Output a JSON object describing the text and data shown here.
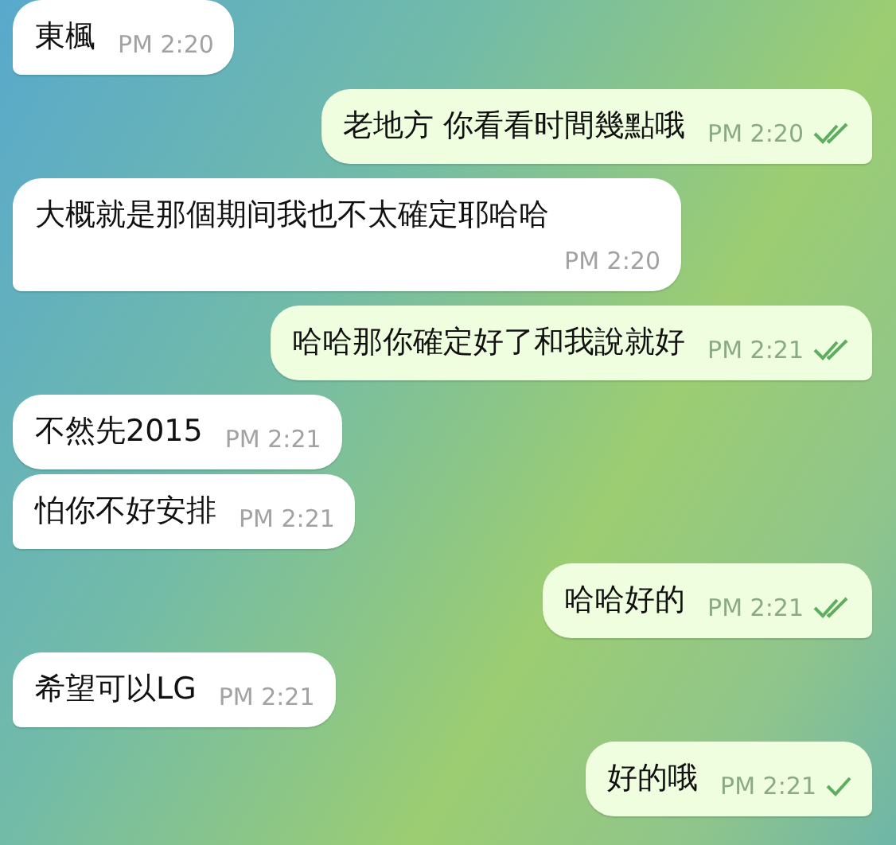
{
  "messages": [
    {
      "outgoing": false,
      "text": "東楓",
      "time": "PM 2:20",
      "tail": true
    },
    {
      "outgoing": true,
      "text": "老地方 你看看时間幾點哦",
      "time": "PM 2:20",
      "read": true,
      "tail": true
    },
    {
      "outgoing": false,
      "text": "大概就是那個期间我也不太確定耶哈哈",
      "time": "PM 2:20",
      "tail": true
    },
    {
      "outgoing": true,
      "text": "哈哈那你確定好了和我說就好",
      "time": "PM 2:21",
      "read": true,
      "tail": true
    },
    {
      "outgoing": false,
      "text": "不然先2015",
      "time": "PM 2:21",
      "tail": false
    },
    {
      "outgoing": false,
      "text": "怕你不好安排",
      "time": "PM 2:21",
      "tail": true
    },
    {
      "outgoing": true,
      "text": "哈哈好的",
      "time": "PM 2:21",
      "read": true,
      "tail": true
    },
    {
      "outgoing": false,
      "text": "希望可以LG",
      "time": "PM 2:21",
      "tail": true
    },
    {
      "outgoing": true,
      "text": "好的哦",
      "time": "PM 2:21",
      "read": false,
      "tail": true
    }
  ]
}
